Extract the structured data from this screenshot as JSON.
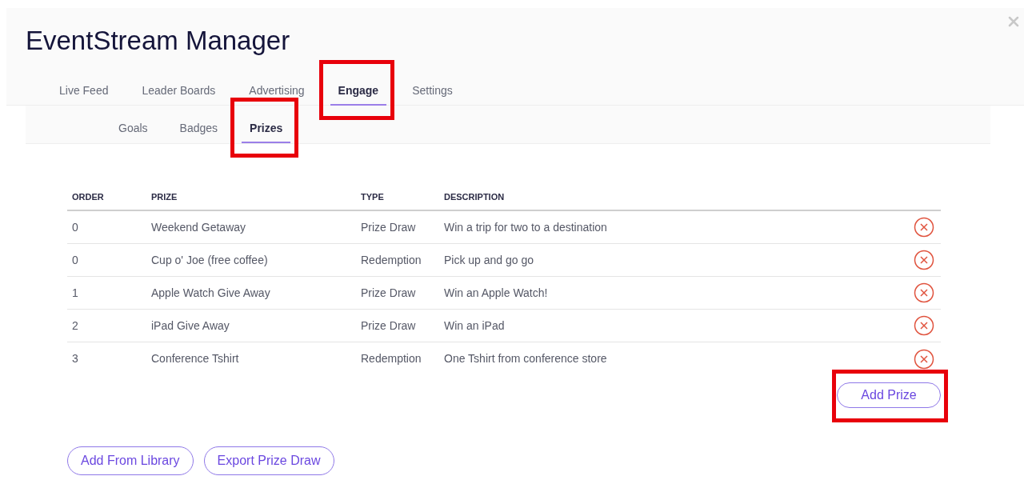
{
  "window": {
    "title": "EventStream Manager"
  },
  "tabs": [
    {
      "label": "Live Feed",
      "selected": false,
      "highlighted": false
    },
    {
      "label": "Leader Boards",
      "selected": false,
      "highlighted": false
    },
    {
      "label": "Advertising",
      "selected": false,
      "highlighted": false
    },
    {
      "label": "Engage",
      "selected": true,
      "highlighted": true
    },
    {
      "label": "Settings",
      "selected": false,
      "highlighted": false
    }
  ],
  "subtabs": [
    {
      "label": "Goals",
      "selected": false,
      "highlighted": false
    },
    {
      "label": "Badges",
      "selected": false,
      "highlighted": false
    },
    {
      "label": "Prizes",
      "selected": true,
      "highlighted": true
    }
  ],
  "table": {
    "columns": [
      "ORDER",
      "PRIZE",
      "TYPE",
      "DESCRIPTION"
    ],
    "rows": [
      {
        "order": "0",
        "prize": "Weekend Getaway",
        "type": "Prize Draw",
        "description": "Win a trip for two to a destination"
      },
      {
        "order": "0",
        "prize": "Cup o' Joe (free coffee)",
        "type": "Redemption",
        "description": "Pick up and go go"
      },
      {
        "order": "1",
        "prize": "Apple Watch Give Away",
        "type": "Prize Draw",
        "description": "Win an Apple Watch!"
      },
      {
        "order": "2",
        "prize": "iPad Give Away",
        "type": "Prize Draw",
        "description": "Win an iPad"
      },
      {
        "order": "3",
        "prize": "Conference Tshirt",
        "type": "Redemption",
        "description": "One Tshirt from conference store"
      }
    ]
  },
  "add_button": {
    "label": "Add Prize",
    "highlighted": true
  },
  "footer_buttons": [
    "Add From Library",
    "Export Prize Draw"
  ]
}
